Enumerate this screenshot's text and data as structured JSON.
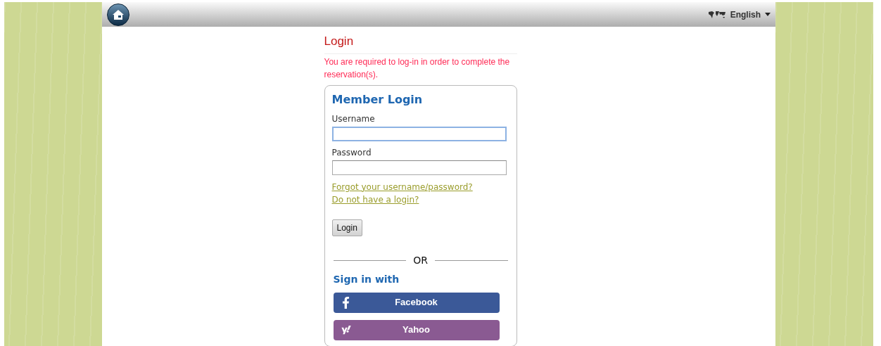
{
  "header": {
    "language": "English"
  },
  "login": {
    "title": "Login",
    "notice": "You are required to log-in in order to complete the reservation(s).",
    "form": {
      "title": "Member Login",
      "fields": [
        {
          "label": "Username",
          "focused": true
        },
        {
          "label": "Password",
          "focused": false
        }
      ],
      "links": [
        "Forgot your username/password?",
        "Do not have a login?"
      ],
      "submit": "Login",
      "divider": "OR",
      "social_title": "Sign in with",
      "social": [
        {
          "kind": "facebook",
          "label": "Facebook",
          "color": "#3b5998"
        },
        {
          "kind": "yahoo",
          "label": "Yahoo",
          "color": "#8a5a92"
        }
      ]
    }
  }
}
